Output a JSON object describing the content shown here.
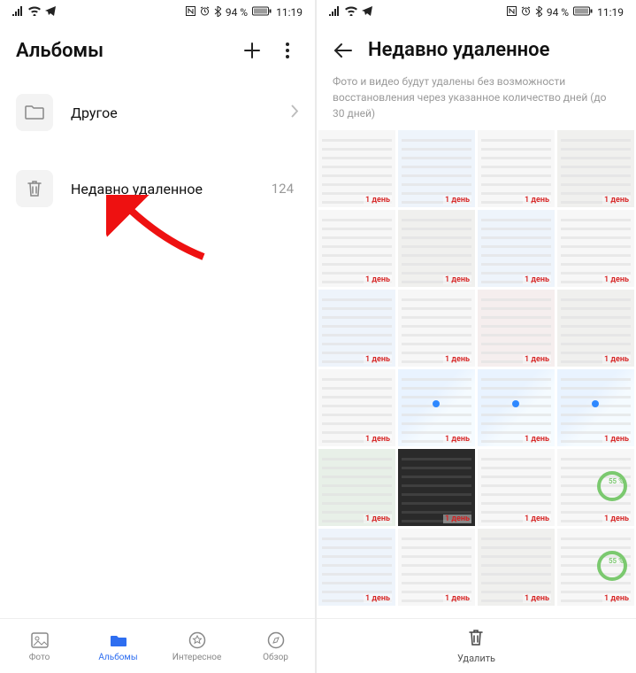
{
  "status": {
    "battery_text": "94 %",
    "time": "11:19"
  },
  "left": {
    "title": "Альбомы",
    "rows": {
      "other": {
        "label": "Другое"
      },
      "deleted": {
        "label": "Недавно удаленное",
        "count": "124"
      }
    },
    "nav": {
      "photo": "Фото",
      "albums": "Альбомы",
      "interesting": "Интересное",
      "overview": "Обзор"
    }
  },
  "right": {
    "title": "Недавно удаленное",
    "subtext": "Фото и видео будут удалены без возможности восстановления через указанное количество дней (до 30 дней)",
    "badge": "1 день",
    "ring_text": "55 %",
    "delete_label": "Удалить"
  }
}
